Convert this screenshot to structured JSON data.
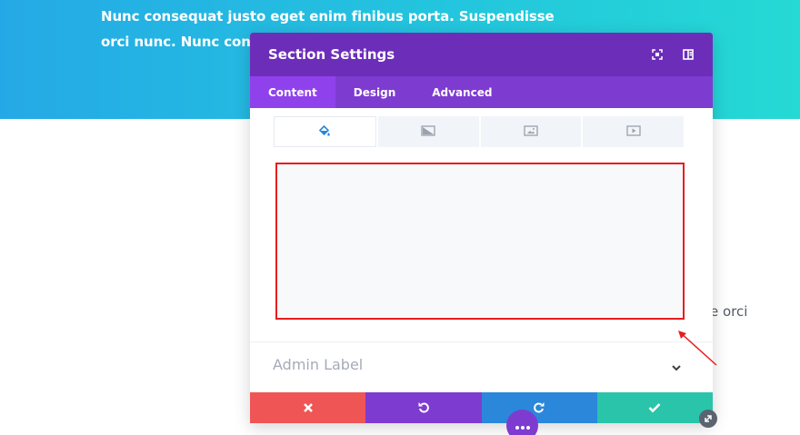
{
  "page": {
    "hero_text": "Nunc consequat justo eget enim finibus porta. Suspendisse orci nunc. Nunc consequat",
    "right_text": "e orci"
  },
  "modal": {
    "title": "Section Settings",
    "tabs": [
      {
        "label": "Content",
        "active": true
      },
      {
        "label": "Design",
        "active": false
      },
      {
        "label": "Advanced",
        "active": false
      }
    ],
    "subtabs": [
      {
        "icon": "paint-bucket-icon",
        "active": true
      },
      {
        "icon": "gradient-icon",
        "active": false
      },
      {
        "icon": "image-icon",
        "active": false
      },
      {
        "icon": "video-icon",
        "active": false
      }
    ],
    "admin_label": "Admin Label",
    "footer_buttons": [
      "discard",
      "undo",
      "redo",
      "save"
    ]
  },
  "colors": {
    "header": "#6c2eb9",
    "tabs": "#7e3bd0",
    "discard": "#ef5555",
    "redo": "#2b87da",
    "save": "#29c4a9",
    "highlight": "#e81d1d"
  }
}
